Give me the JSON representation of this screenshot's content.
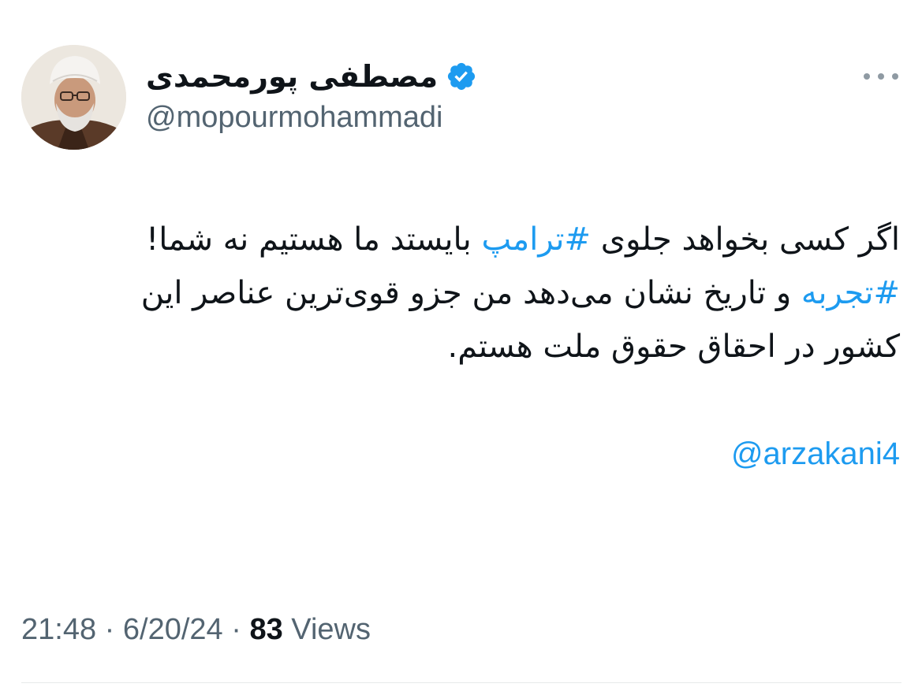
{
  "author": {
    "display_name": "مصطفی پورمحمدی",
    "handle": "@mopourmohammadi",
    "verified": true,
    "verified_icon": "verified-badge-icon"
  },
  "tweet": {
    "line1": {
      "before": "اگر کسی بخواهد جلوی ",
      "hashtag": "#ترامپ",
      "after": " بایستد ما هستیم نه شما!"
    },
    "line2": {
      "hashtag": "#تجربه",
      "after": " و تاریخ نشان می‌دهد من جزو قوی‌ترین عناصر این"
    },
    "line3": "کشور در احقاق حقوق ملت هستم.",
    "mention": "@arzakani4"
  },
  "meta": {
    "time": "21:48",
    "separator": " · ",
    "date": "6/20/24",
    "views_count": "83",
    "views_label": " Views"
  },
  "colors": {
    "link": "#1d9bf0",
    "secondary_text": "#536471",
    "primary_text": "#0f1419",
    "divider": "#e7e9ea"
  }
}
